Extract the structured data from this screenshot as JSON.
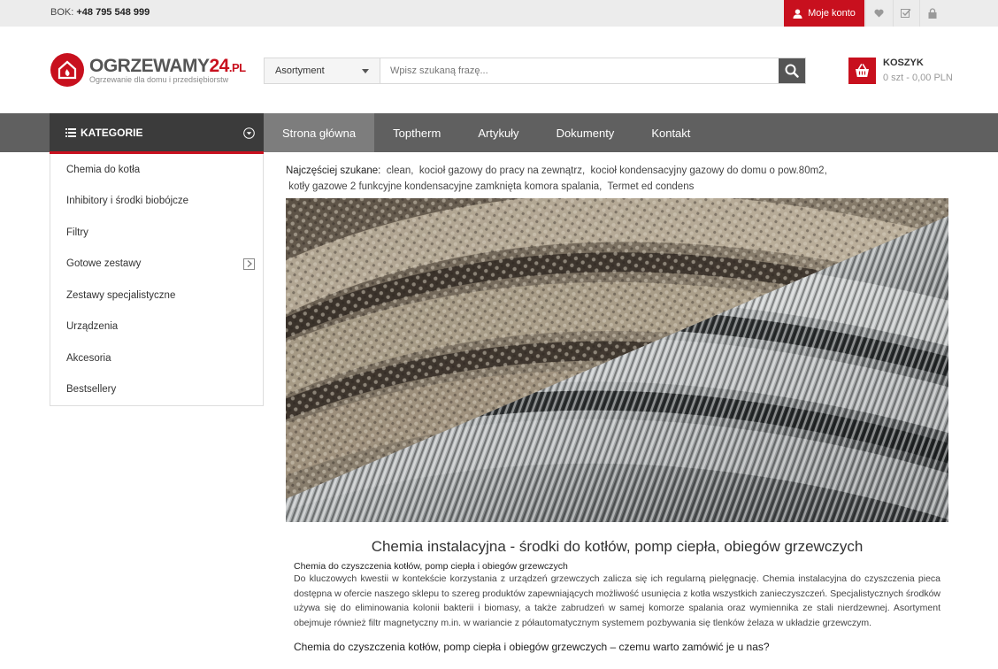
{
  "topbar": {
    "bok_label": "BOK:",
    "phone": "+48 795 548 999",
    "account_label": "Moje konto"
  },
  "logo": {
    "name_part1": "OGRZEWAMY",
    "name_part2": "24",
    "name_part3": ".PL",
    "tagline": "Ogrzewanie dla domu i przedsiębiorstw"
  },
  "search": {
    "category": "Asortyment",
    "placeholder": "Wpisz szukaną frazę..."
  },
  "cart": {
    "title": "KOSZYK",
    "summary": "0 szt - 0,00 PLN"
  },
  "nav": {
    "categories_label": "KATEGORIE",
    "items": [
      {
        "label": "Strona główna"
      },
      {
        "label": "Toptherm"
      },
      {
        "label": "Artykuły"
      },
      {
        "label": "Dokumenty"
      },
      {
        "label": "Kontakt"
      }
    ]
  },
  "sidebar": {
    "items": [
      {
        "label": "Chemia do kotła"
      },
      {
        "label": "Inhibitory i środki biobójcze"
      },
      {
        "label": "Filtry"
      },
      {
        "label": "Gotowe zestawy"
      },
      {
        "label": "Zestawy specjalistyczne"
      },
      {
        "label": "Urządzenia"
      },
      {
        "label": "Akcesoria"
      },
      {
        "label": "Bestsellery"
      }
    ]
  },
  "popular": {
    "label": "Najczęściej szukane:",
    "terms": [
      "clean,",
      "kocioł gazowy do pracy na zewnątrz,",
      "kocioł kondensacyjny gazowy do domu o pow.80m2,",
      "kotły gazowe 2 funkcyjne kondensacyjne zamknięta komora spalania,",
      "Termet ed condens"
    ]
  },
  "article": {
    "title": "Chemia instalacyjna - środki do kotłów, pomp ciepła, obiegów grzewczych",
    "subtitle": "Chemia do czyszczenia kotłów, pomp ciepła i obiegów grzewczych",
    "text": "Do kluczowych kwestii w kontekście korzystania z urządzeń grzewczych zalicza się ich regularną pielęgnację. Chemia instalacyjna do czyszczenia pieca dostępna w ofercie naszego sklepu to szereg produktów zapewniających możliwość usunięcia z kotła wszystkich zanieczyszczeń. Specjalistycznych środków używa się do eliminowania kolonii bakterii i biomasy, a także zabrudzeń w samej komorze spalania oraz wymiennika ze stali nierdzewnej. Asortyment obejmuje również filtr magnetyczny m.in. w wariancie z półautomatycznym systemem pozbywania się tlenków żelaza w układzie grzewczym.",
    "subtitle2": "Chemia do czyszczenia kotłów, pomp ciepła i obiegów grzewczych – czemu warto zamówić je u nas?"
  },
  "colors": {
    "brand_red": "#c8101e",
    "nav_bg": "#606060",
    "nav_active": "#7d7d7d",
    "kat_bg": "#3b3b3b"
  }
}
